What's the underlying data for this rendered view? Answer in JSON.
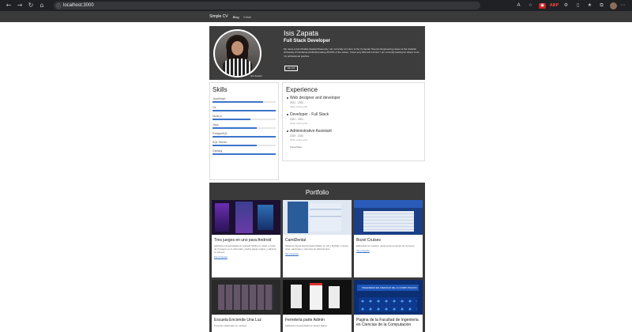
{
  "browser": {
    "url": "localhost:3000",
    "ext_badge": "ABP"
  },
  "nav": {
    "brand": "Simple CV",
    "links": [
      "Blog",
      "Gitlab"
    ]
  },
  "profile": {
    "name": "Isis Zapata",
    "title": "Full Stack Developer",
    "bio": "My name is Isis Rivaldo Zapata Plasencia, I am currently an intern of the Computer Science Engineering career at the Catholic University of Honduras (UNICAH) taking 35.06% of the career, I have very little left to finish. I am currently looking for where to do my professional practice.",
    "button": "Ver CV",
    "photo_caption": "Isis Zapata"
  },
  "skills": {
    "heading": "Skills",
    "items": [
      {
        "label": "JavaScript",
        "level": 0.8
      },
      {
        "label": "C#",
        "level": 1.0
      },
      {
        "label": "Node.js",
        "level": 0.6
      },
      {
        "label": "Java",
        "level": 0.7
      },
      {
        "label": "PostgreSQL",
        "level": 1.0
      },
      {
        "label": "SQL Server",
        "level": 0.7
      },
      {
        "label": "Gaming",
        "level": 1.0
      }
    ]
  },
  "experience": {
    "heading": "Experience",
    "jobs": [
      {
        "title": "Web designer and developer",
        "dates": "2021 - 2022",
        "desc": "Work online jobs"
      },
      {
        "title": "Developer - Full Stack",
        "dates": "2021 - 2021",
        "desc": "Work online jobs"
      },
      {
        "title": "Administrative Assistant",
        "dates": "2019 - 2020",
        "desc": "Work online jobs"
      }
    ],
    "more": "Know More"
  },
  "portfolio": {
    "heading": "Portfolio",
    "cards": [
      {
        "title": "Tres juegos en uno para Android",
        "desc": "Aplicacion desarrollada en Android Studio en Java, consta de 3 juegos en si: ahorcado, piedra papel o tijera, y adivina el numero.",
        "link": "Ver proyecto"
      },
      {
        "title": "CamiDental",
        "desc": "Sistema clinica Dental desarrollado en C# y MySQL, incluye citas, pacientes y reportes de tratamientos.",
        "link": "Ver proyecto"
      },
      {
        "title": "Bozel Cruises",
        "desc": "Elaborado en Laravel, sistema de reservas de cruceros.",
        "link": "Ver proyecto"
      },
      {
        "title": "Escuela Enciende Una Luz",
        "desc": "Proyecto elaborado en Laravel",
        "link": "Ver proyecto"
      },
      {
        "title": "Ferreteria parte Admin",
        "desc": "Aplicacion desarrollada en React Native",
        "link": "Ver proyecto"
      },
      {
        "title": "Pagina de la Facultad de Ingenieria en Ciencias de la Computacion",
        "desc": "",
        "link": "",
        "thumb_text": "INGENIERIA EN CIENCIAS DE LA COMPUTACION"
      }
    ]
  },
  "colors": {
    "dark": "#3d3d3d",
    "accent": "#3d74c9"
  }
}
